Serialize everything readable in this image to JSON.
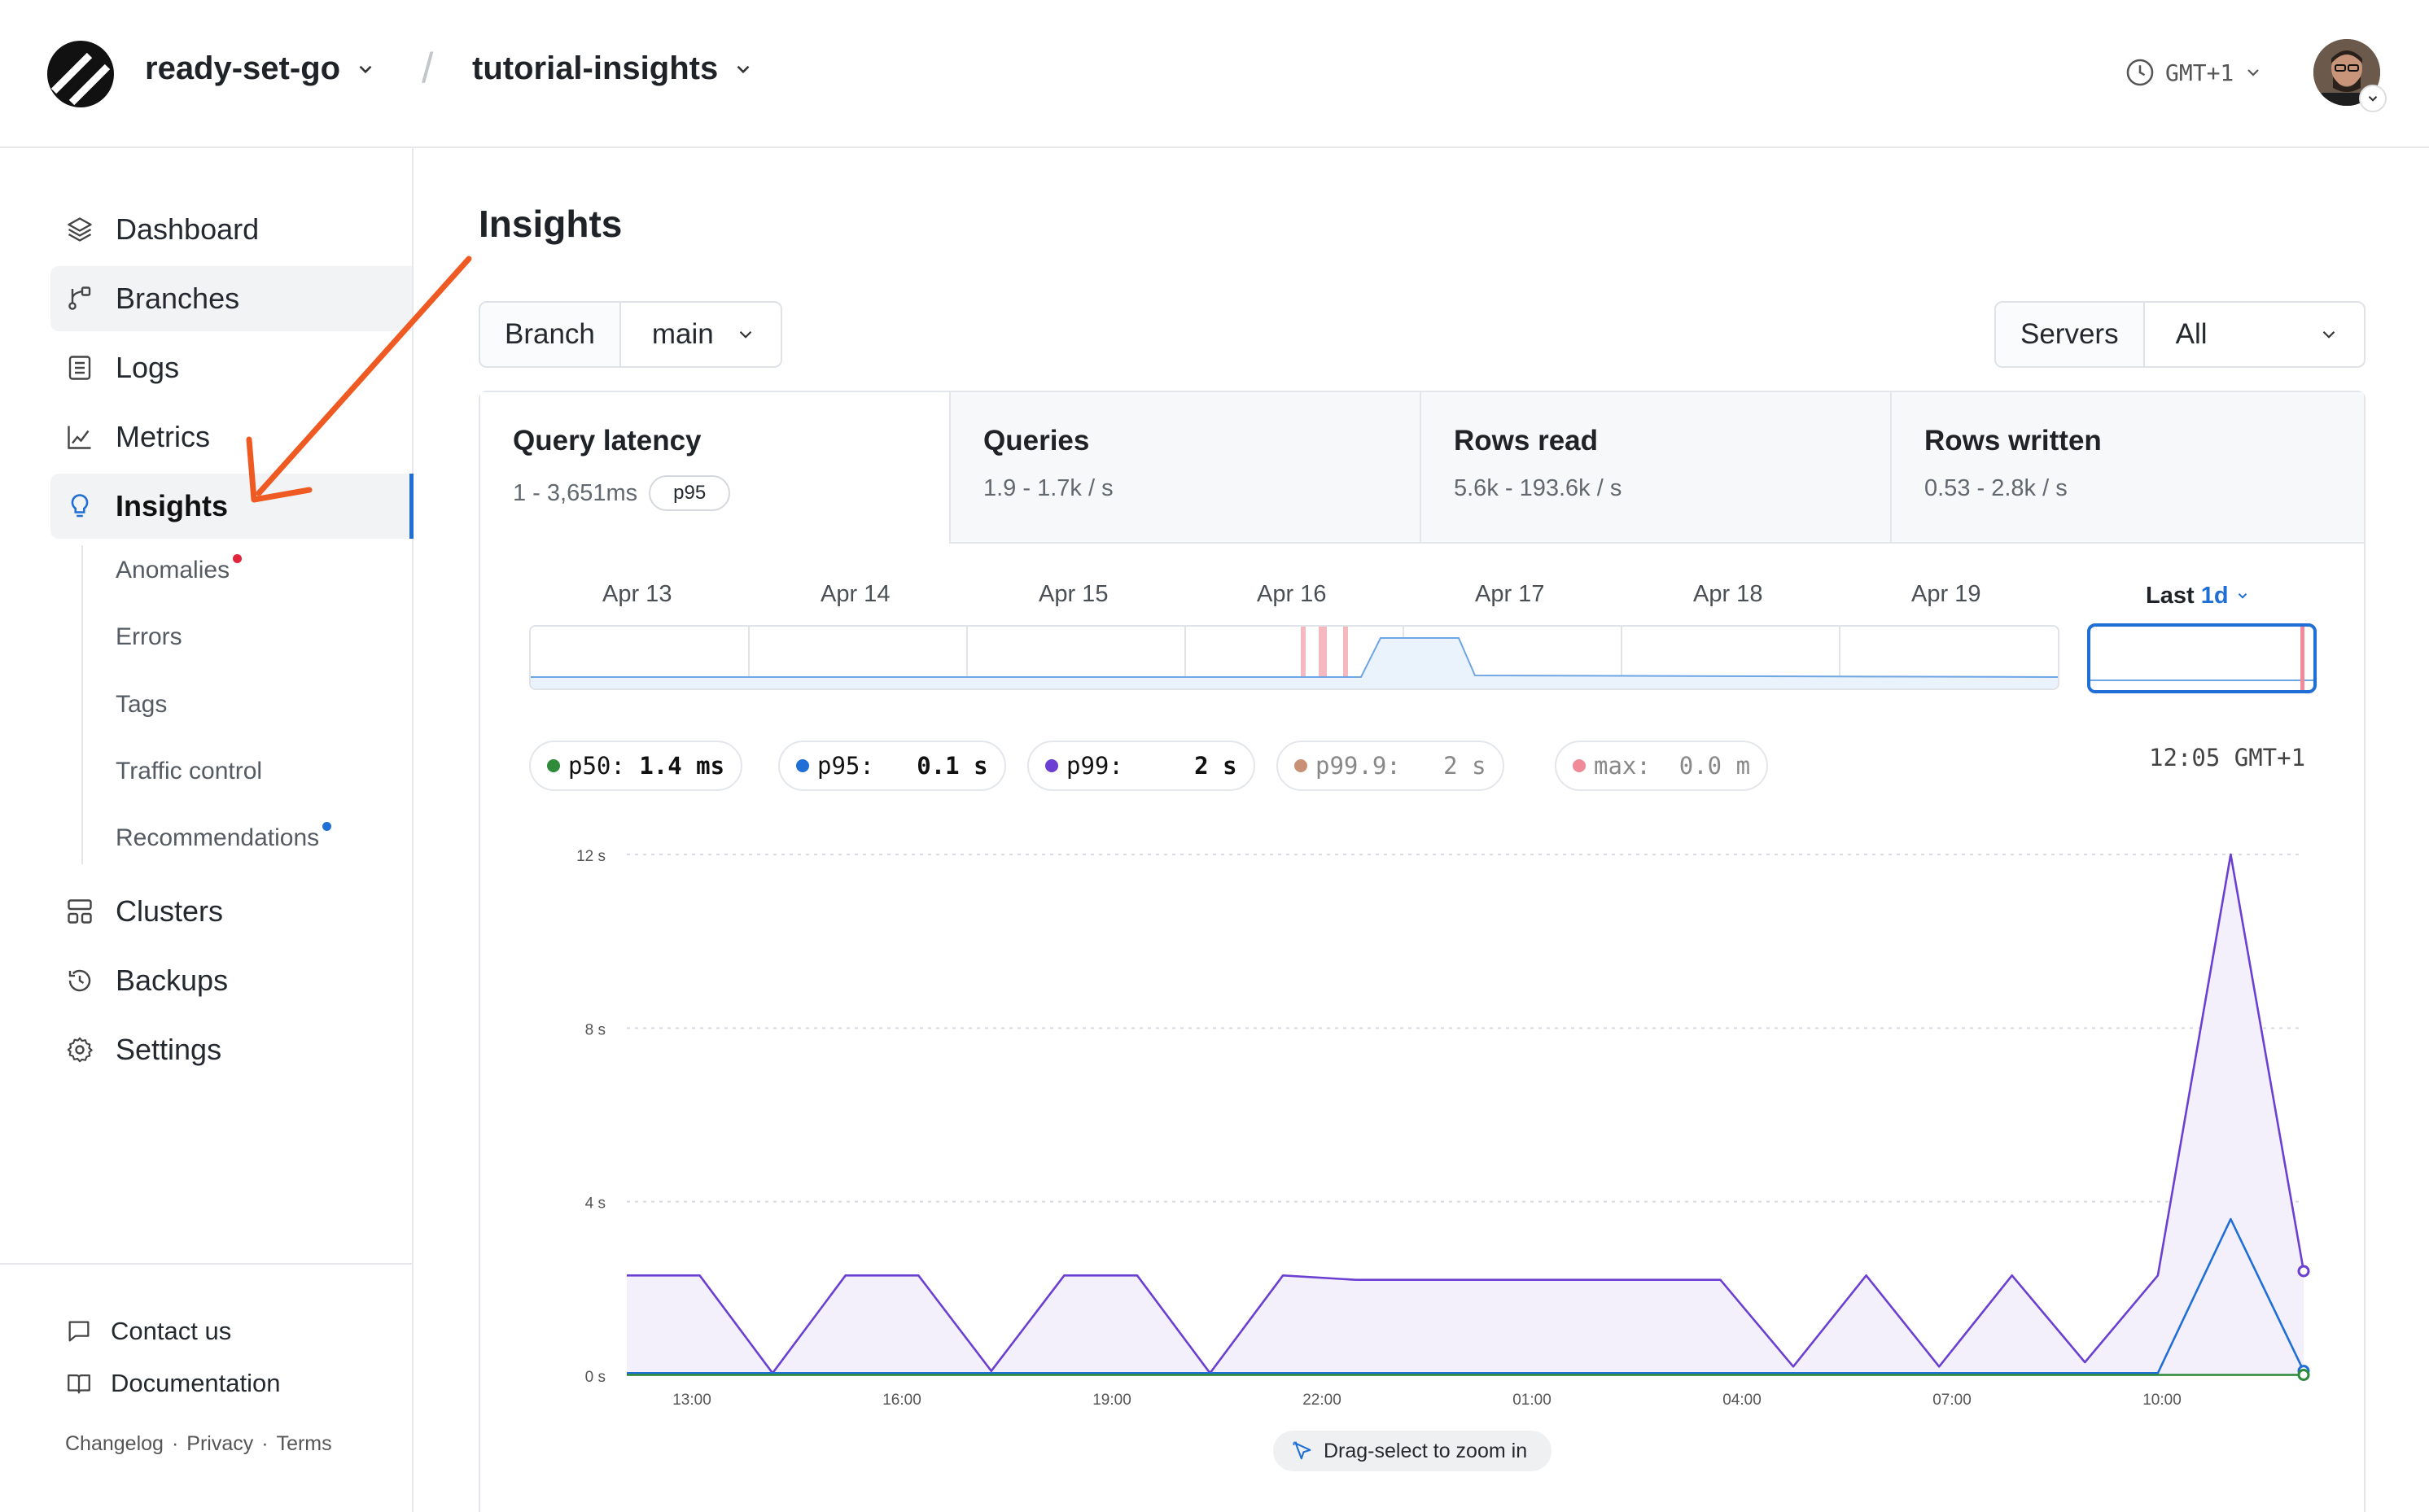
{
  "header": {
    "org": "ready-set-go",
    "separator": "/",
    "database": "tutorial-insights",
    "timezone": "GMT+1"
  },
  "sidebar": {
    "items": [
      {
        "label": "Dashboard",
        "icon": "layers-icon"
      },
      {
        "label": "Branches",
        "icon": "branch-icon"
      },
      {
        "label": "Logs",
        "icon": "logs-icon"
      },
      {
        "label": "Metrics",
        "icon": "metrics-icon"
      },
      {
        "label": "Insights",
        "icon": "lightbulb-icon"
      }
    ],
    "sub_items": [
      "Anomalies",
      "Errors",
      "Tags",
      "Traffic control",
      "Recommendations"
    ],
    "items_bottom": [
      {
        "label": "Clusters",
        "icon": "clusters-icon"
      },
      {
        "label": "Backups",
        "icon": "backup-icon"
      },
      {
        "label": "Settings",
        "icon": "gear-icon"
      }
    ],
    "footer": {
      "contact": "Contact us",
      "docs": "Documentation",
      "changelog": "Changelog",
      "privacy": "Privacy",
      "terms": "Terms",
      "sep": "·"
    }
  },
  "main": {
    "title": "Insights",
    "branch_label": "Branch",
    "branch_value": "main",
    "servers_label": "Servers",
    "servers_value": "All",
    "tabs": [
      {
        "title": "Query latency",
        "sub": "1 - 3,651ms",
        "pill": "p95"
      },
      {
        "title": "Queries",
        "sub": "1.9 - 1.7k / s"
      },
      {
        "title": "Rows read",
        "sub": "5.6k - 193.6k / s"
      },
      {
        "title": "Rows written",
        "sub": "0.53 - 2.8k / s"
      }
    ],
    "overview_dates": [
      "Apr 13",
      "Apr 14",
      "Apr 15",
      "Apr 16",
      "Apr 17",
      "Apr 18",
      "Apr 19"
    ],
    "range_prefix": "Last",
    "range_value": "1d",
    "legend": [
      {
        "name": "p50:",
        "value": "1.4 ms",
        "color": "#2e8b3a"
      },
      {
        "name": "p95:",
        "value": "0.1 s",
        "color": "#1f6fd6"
      },
      {
        "name": "p99:",
        "value": "  2 s",
        "color": "#6a3fd1"
      },
      {
        "name": "p99.9:",
        "value": "  2 s",
        "color": "#c89074"
      },
      {
        "name": "max:",
        "value": "0.0 m",
        "color": "#f08a98"
      }
    ],
    "current_time": "12:05 GMT+1",
    "hint": "Drag-select to zoom in"
  },
  "chart_data": {
    "type": "line",
    "yticks": [
      "0 s",
      "4 s",
      "8 s",
      "12 s"
    ],
    "ylim": [
      0,
      12
    ],
    "xticks": [
      "13:00",
      "16:00",
      "19:00",
      "22:00",
      "01:00",
      "04:00",
      "07:00",
      "10:00"
    ],
    "series": [
      {
        "name": "p50",
        "color": "#2e8b3a",
        "values": [
          0.01,
          0.01,
          0.01,
          0.01,
          0.01,
          0.01,
          0.01,
          0.01,
          0.01,
          0.01,
          0.01,
          0.01,
          0.01,
          0.01,
          0.01,
          0.01,
          0.01,
          0.01,
          0.01,
          0.01,
          0.01,
          0.01,
          0.01,
          0.01
        ]
      },
      {
        "name": "p95",
        "color": "#1f6fd6",
        "values": [
          0.05,
          0.05,
          0.05,
          0.05,
          0.05,
          0.05,
          0.05,
          0.05,
          0.05,
          0.05,
          0.05,
          0.05,
          0.05,
          0.05,
          0.05,
          0.05,
          0.05,
          0.05,
          0.05,
          0.05,
          0.05,
          0.05,
          3.6,
          0.1
        ]
      },
      {
        "name": "p99",
        "color": "#6a3fd1",
        "values": [
          2.3,
          2.3,
          0.05,
          2.3,
          2.3,
          0.1,
          2.3,
          2.3,
          0.05,
          2.3,
          2.2,
          2.2,
          2.2,
          2.2,
          2.2,
          2.2,
          0.2,
          2.3,
          0.2,
          2.3,
          0.3,
          2.3,
          12.0,
          2.4
        ]
      }
    ]
  }
}
